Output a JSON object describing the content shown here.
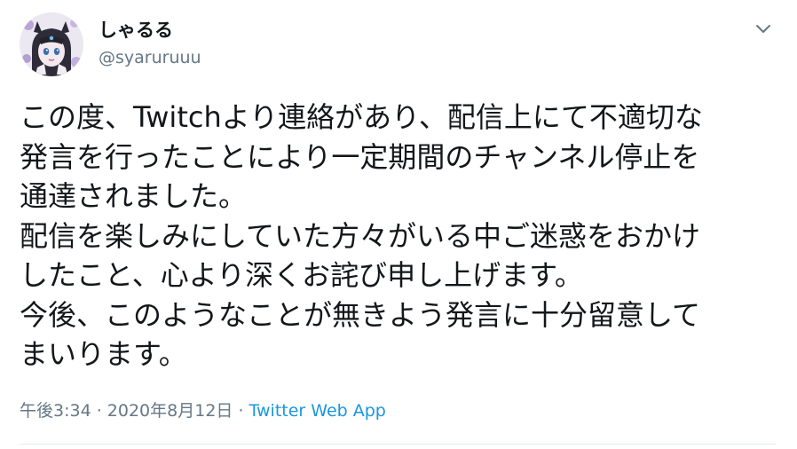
{
  "author": {
    "display_name": "しゃるる",
    "handle": "@syaruruuu"
  },
  "tweet": {
    "lines": [
      "この度、Twitchより連絡があり、配信上にて不適切な",
      "発言を行ったことにより一定期間のチャンネル停止を",
      "通達されました。",
      "配信を楽しみにしていた方々がいる中ご迷惑をおかけ",
      "したこと、心より深くお詫び申し上げます。",
      "今後、このようなことが無きよう発言に十分留意して",
      "まいります。"
    ]
  },
  "meta": {
    "time": "午後3:34",
    "separator1": " · ",
    "date": "2020年8月12日",
    "separator2": " · ",
    "source": "Twitter Web App"
  },
  "colors": {
    "text": "#14171a",
    "secondary": "#657786",
    "link": "#1b95e0",
    "divider": "#e6ecf0"
  },
  "icons": {
    "menu": "chevron-down-icon",
    "avatar": "avatar"
  }
}
